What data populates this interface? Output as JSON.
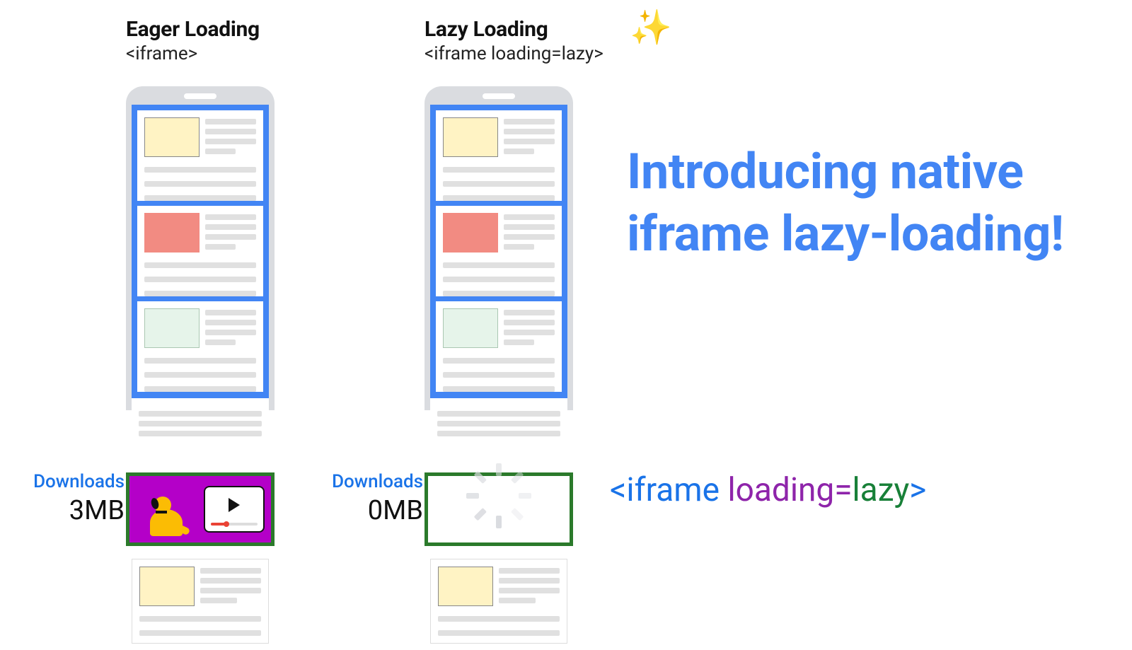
{
  "columns": {
    "eager": {
      "title": "Eager Loading",
      "subtitle": "<iframe>",
      "download_label": "Downloads",
      "download_value": "3MB"
    },
    "lazy": {
      "title": "Lazy Loading",
      "subtitle": "<iframe loading=lazy>",
      "download_label": "Downloads",
      "download_value": "0MB"
    }
  },
  "headline": "Introducing native iframe lazy-loading!",
  "snippet": {
    "open": "<",
    "tag": "iframe",
    "space1": " ",
    "attr": "loading",
    "eq": "=",
    "val": "lazy",
    "close": ">"
  },
  "icons": {
    "sparkles": "✨"
  }
}
